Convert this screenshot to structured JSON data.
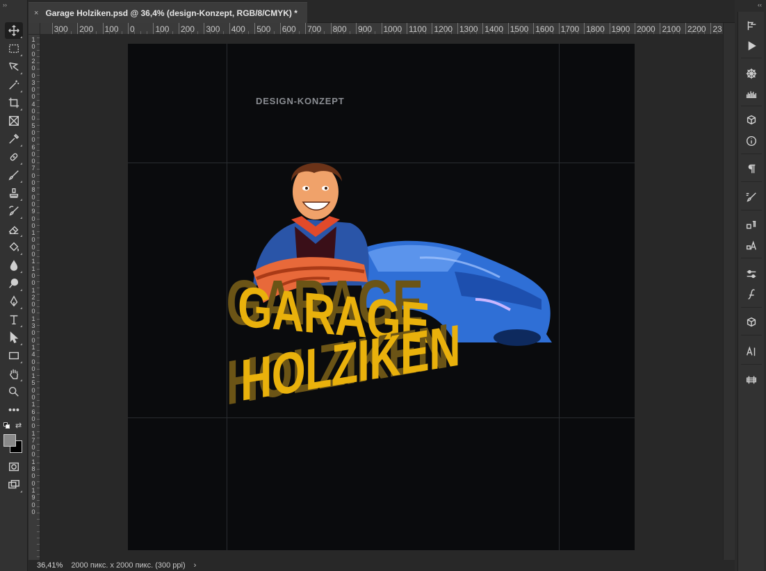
{
  "document": {
    "tab_title": "Garage Holziken.psd @ 36,4% (design-Konzept, RGB/8/CMYK) *",
    "close_glyph": "×"
  },
  "ruler": {
    "top_labels": [
      "300",
      "200",
      "100",
      "0",
      "100",
      "200",
      "300",
      "400",
      "500",
      "600",
      "700",
      "800",
      "900",
      "1000",
      "1100",
      "1200",
      "1300",
      "1400",
      "1500",
      "1600",
      "1700",
      "1800",
      "1900",
      "2000",
      "2100",
      "2200",
      "23"
    ],
    "left_labels": [
      "1",
      "0",
      "0",
      "2",
      "0",
      "0",
      "3",
      "0",
      "0",
      "4",
      "0",
      "0",
      "5",
      "0",
      "0",
      "6",
      "0",
      "0",
      "7",
      "0",
      "0",
      "8",
      "0",
      "0",
      "9",
      "0",
      "0",
      "1",
      "0",
      "0",
      "0",
      "1",
      "1",
      "0",
      "0",
      "1",
      "2",
      "0",
      "0",
      "1",
      "3",
      "0",
      "0",
      "1",
      "4",
      "0",
      "0",
      "1",
      "5",
      "0",
      "0",
      "1",
      "6",
      "0",
      "0",
      "1",
      "7",
      "0",
      "0",
      "1",
      "8",
      "0",
      "0",
      "1",
      "9",
      "0",
      "0"
    ]
  },
  "canvas": {
    "design_label": "DESIGN-KONZEPT",
    "logo": {
      "line1": "GARAGE",
      "line2": "HOLZIKEN",
      "text_color": "#e9b10c",
      "shadow_color": "#6b5416",
      "car_color": "#2f6fd6",
      "shirt_color": "#2a55a8"
    }
  },
  "status": {
    "zoom": "36,41%",
    "doc_info": "2000 пикс. x 2000 пикс. (300 ppi)",
    "chevron": "›"
  },
  "colors": {
    "foreground": "#8a8a8a",
    "background": "#000000",
    "artboard": "#0a0b0d"
  },
  "tools": {
    "left": [
      "move-icon",
      "rectangular-marquee-icon",
      "lasso-icon",
      "magic-wand-icon",
      "crop-icon",
      "frame-icon",
      "eyedropper-icon",
      "healing-brush-icon",
      "brush-icon",
      "clone-stamp-icon",
      "history-brush-icon",
      "eraser-icon",
      "paint-bucket-icon",
      "blur-icon",
      "dodge-icon",
      "pen-icon",
      "type-icon",
      "path-selection-icon",
      "rectangle-icon",
      "hand-icon",
      "zoom-icon",
      "more-tools-icon"
    ],
    "right": [
      "history-icon",
      "actions-icon",
      "adjustments-icon",
      "histogram-icon",
      "3d-materials-icon",
      "info-icon",
      "paragraph-icon",
      "brush-settings-icon",
      "paragraph-styles-icon",
      "character-styles-icon",
      "properties-icon",
      "glyphs-icon",
      "3d-icon",
      "character-icon",
      "timeline-icon"
    ]
  }
}
